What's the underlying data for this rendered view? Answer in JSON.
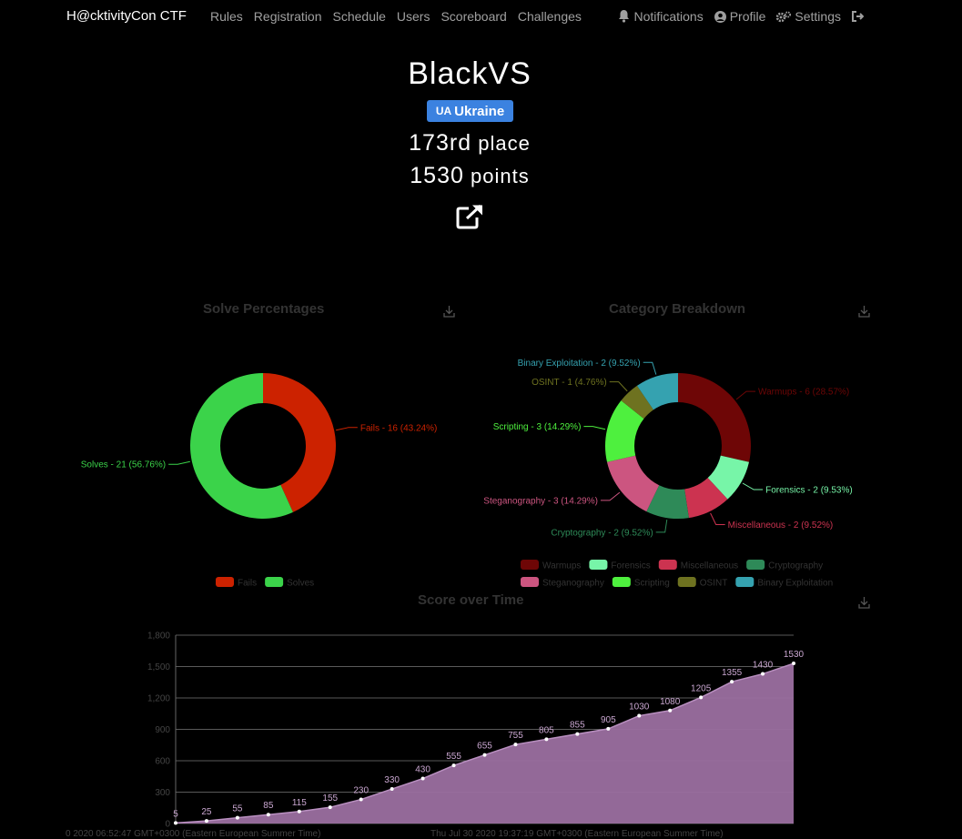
{
  "nav": {
    "brand": "H@cktivityCon CTF",
    "links": [
      "Rules",
      "Registration",
      "Schedule",
      "Users",
      "Scoreboard",
      "Challenges"
    ],
    "notifications": "Notifications",
    "profile": "Profile",
    "settings": "Settings"
  },
  "team": {
    "name": "BlackVS",
    "country_code": "UA",
    "country": "Ukraine",
    "place_number": "173rd",
    "place_word": "place",
    "points_number": "1530",
    "points_word": "points"
  },
  "colors": {
    "country_badge": "#3b82e0",
    "fails": "#cc2200",
    "solves": "#3bd34a",
    "area": "#9b6fa0"
  },
  "icons": [
    "bell-icon",
    "user-circle-icon",
    "gears-icon",
    "logout-icon",
    "external-link-icon",
    "download-icon"
  ],
  "chart_data": [
    {
      "type": "pie",
      "title": "Solve Percentages",
      "categories": [
        "Fails",
        "Solves"
      ],
      "values": [
        16,
        21
      ],
      "labels": [
        "Fails - 16 (43.24%)",
        "Solves - 21 (56.76%)"
      ],
      "colors": [
        "#cc2200",
        "#3bd34a"
      ],
      "legend": "bottom"
    },
    {
      "type": "pie",
      "title": "Category Breakdown",
      "categories": [
        "Warmups",
        "Forensics",
        "Miscellaneous",
        "Cryptography",
        "Steganography",
        "Scripting",
        "OSINT",
        "Binary Exploitation"
      ],
      "values": [
        6,
        2,
        2,
        2,
        3,
        3,
        1,
        2
      ],
      "labels": [
        "Warmups - 6 (28.57%)",
        "Forensics - 2 (9.53%)",
        "Miscellaneous - 2 (9.52%)",
        "Cryptography - 2 (9.52%)",
        "Steganography - 3 (14.29%)",
        "Scripting - 3 (14.29%)",
        "OSINT - 1 (4.76%)",
        "Binary Exploitation - 2 (9.52%)"
      ],
      "colors": [
        "#6e0606",
        "#77f5a8",
        "#cc3350",
        "#2e8a58",
        "#cc5580",
        "#4ef03e",
        "#6e7220",
        "#35a2b0"
      ],
      "legend": "bottom"
    },
    {
      "type": "area",
      "title": "Score over Time",
      "values": [
        5,
        25,
        55,
        85,
        115,
        155,
        230,
        330,
        430,
        555,
        655,
        755,
        805,
        855,
        905,
        1030,
        1080,
        1205,
        1355,
        1430,
        1530
      ],
      "ylim": [
        0,
        1800
      ],
      "yticks": [
        "0",
        "300",
        "600",
        "900",
        "1,200",
        "1,500",
        "1,800"
      ],
      "xticks": [
        "0 2020 06:52:47 GMT+0300 (Eastern European Summer Time)",
        "Thu Jul 30 2020 19:37:19 GMT+0300 (Eastern European Summer Time)"
      ],
      "grid": true,
      "color": "#9b6fa0"
    }
  ]
}
